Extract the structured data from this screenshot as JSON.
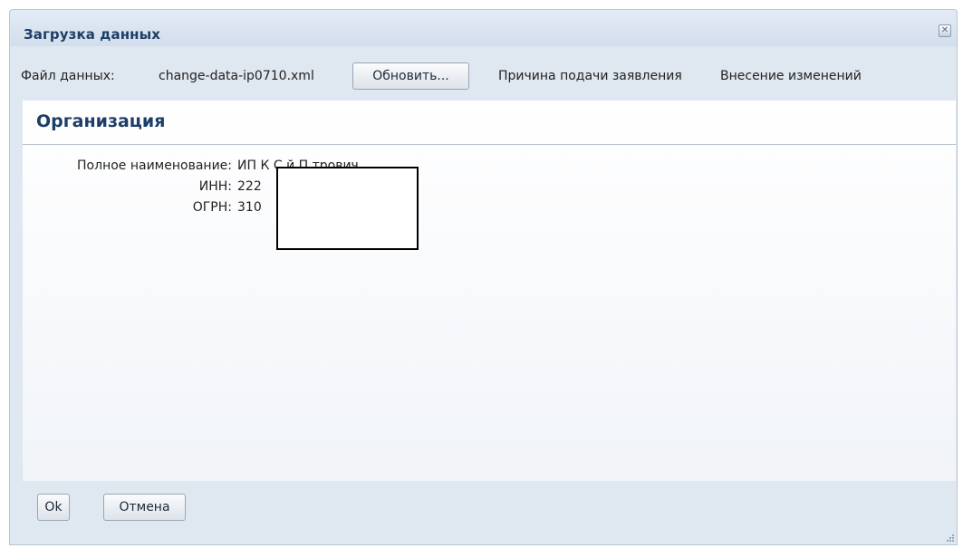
{
  "dialog": {
    "title": "Загрузка данных",
    "close_icon": "close-icon"
  },
  "file_row": {
    "label": "Файл данных:",
    "file_name": "change-data-ip0710.xml",
    "refresh_button": "Обновить...",
    "reason_label": "Причина подачи заявления",
    "reason_value": "Внесение изменений"
  },
  "organization": {
    "section_title": "Организация",
    "fields": [
      {
        "label": "Полное наименование:",
        "value": "ИП К       С      й П трович"
      },
      {
        "label": "ИНН:",
        "value": "222"
      },
      {
        "label": "ОГРН:",
        "value": "310"
      }
    ]
  },
  "footer": {
    "ok_button": "Ok",
    "cancel_button": "Отмена"
  },
  "colors": {
    "title_text": "#1d3e66",
    "dialog_background": "#dfe7f1"
  }
}
